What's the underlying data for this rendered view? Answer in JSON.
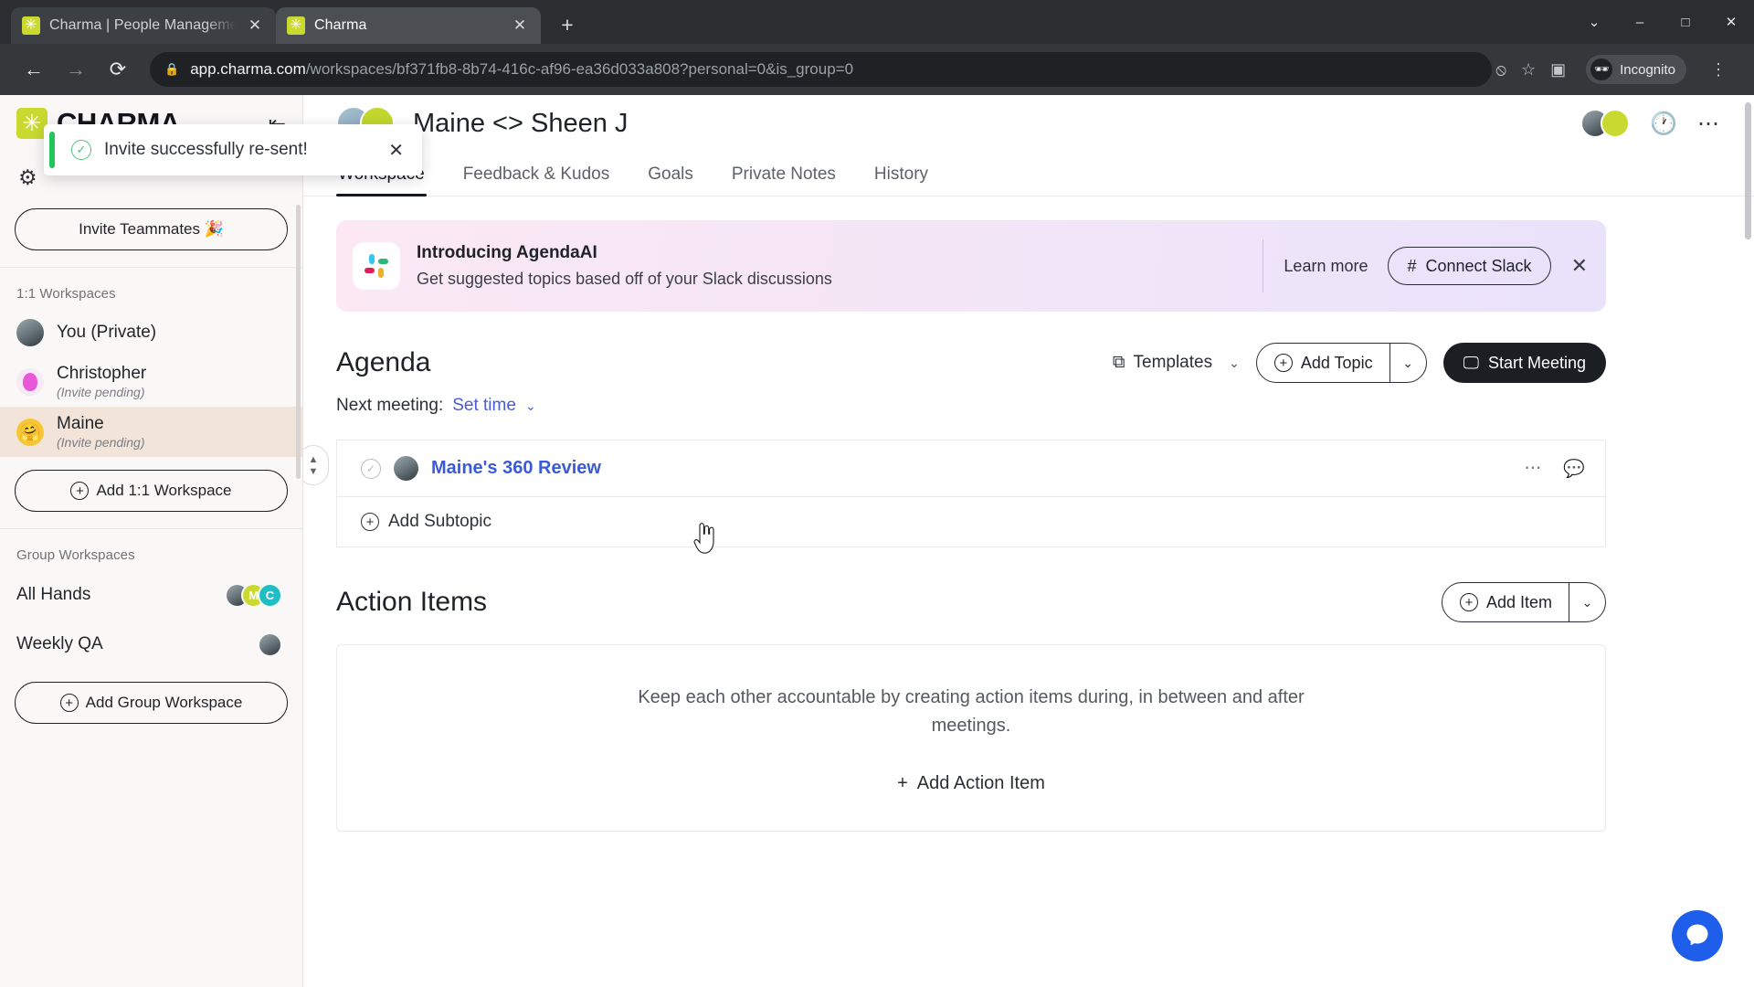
{
  "browser": {
    "tabs": [
      {
        "title": "Charma | People Management S",
        "favicon": "charma-icon",
        "active": false
      },
      {
        "title": "Charma",
        "favicon": "charma-icon",
        "active": true
      }
    ],
    "new_tab_label": "+",
    "window_controls": {
      "minimize": "–",
      "maximize": "□",
      "close": "✕",
      "expand": "⌄"
    },
    "nav": {
      "back": "←",
      "forward": "→",
      "reload": "⟳"
    },
    "url": {
      "lock": "🔒",
      "domain": "app.charma.com",
      "path": "/workspaces/bf371fb8-8b74-416c-af96-ea36d033a808?personal=0&is_group=0"
    },
    "omni_icons": {
      "block": "⦸",
      "bookmark": "☆",
      "sidepanel": "▣"
    },
    "profile": {
      "label": "Incognito",
      "icon": "incognito-icon"
    },
    "menu": "⋮"
  },
  "toast": {
    "message": "Invite successfully re-sent!",
    "icon": "check-circle-icon",
    "close": "✕",
    "accent_color": "#22c55e"
  },
  "sidebar": {
    "logo": "CHARMA",
    "collapse_icon": "collapse-left-icon",
    "settings_icon": "gear-icon",
    "invite_button": "Invite Teammates 🎉",
    "sections": [
      {
        "label": "1:1 Workspaces",
        "items": [
          {
            "name": "You (Private)",
            "sub": "",
            "avatar": "photo",
            "active": false
          },
          {
            "name": "Christopher",
            "sub": "(Invite pending)",
            "avatar": "pink",
            "active": false
          },
          {
            "name": "Maine",
            "sub": "(Invite pending)",
            "avatar": "yellow",
            "active": true
          }
        ],
        "add_button": "Add 1:1 Workspace"
      },
      {
        "label": "Group Workspaces",
        "items": [
          {
            "name": "All Hands",
            "avatars": [
              "photo",
              "M",
              "C"
            ]
          },
          {
            "name": "Weekly QA",
            "avatars": [
              "photo"
            ]
          }
        ],
        "add_button": "Add Group Workspace"
      }
    ]
  },
  "header": {
    "title": "Maine <> Sheen J",
    "avatars": [
      "blue",
      "green"
    ],
    "right_avatars": [
      "photo",
      "green"
    ],
    "history_icon": "clock-icon",
    "more_icon": "more-horizontal-icon"
  },
  "tabs": [
    {
      "label": "Workspace",
      "active": true
    },
    {
      "label": "Feedback & Kudos",
      "active": false
    },
    {
      "label": "Goals",
      "active": false
    },
    {
      "label": "Private Notes",
      "active": false
    },
    {
      "label": "History",
      "active": false
    }
  ],
  "banner": {
    "icon": "slack-icon",
    "title": "Introducing AgendaAI",
    "subtitle": "Get suggested topics based off of your Slack discussions",
    "learn_more": "Learn more",
    "connect_button": "Connect Slack",
    "close": "✕"
  },
  "agenda": {
    "title": "Agenda",
    "templates_label": "Templates",
    "templates_caret": "⌄",
    "add_topic_label": "Add Topic",
    "add_topic_caret": "⌄",
    "start_meeting_label": "Start Meeting",
    "next_meeting_label": "Next meeting:",
    "set_time_label": "Set time",
    "set_time_caret": "⌄",
    "topics": [
      {
        "name": "Maine's 360 Review",
        "check_icon": "check-circle-icon",
        "avatar": "photo",
        "more_icon": "more-horizontal-icon",
        "comment_icon": "comment-icon"
      }
    ],
    "add_subtopic_label": "Add Subtopic",
    "drag_handle": "drag-handle-icon"
  },
  "action_items": {
    "title": "Action Items",
    "add_item_label": "Add Item",
    "add_item_caret": "⌄",
    "empty_text": "Keep each other accountable by creating action items during, in between and after meetings.",
    "add_action_label": "Add Action Item",
    "add_action_plus": "+"
  },
  "support": {
    "icon": "intercom-chat-icon",
    "color": "#1f5eea"
  }
}
